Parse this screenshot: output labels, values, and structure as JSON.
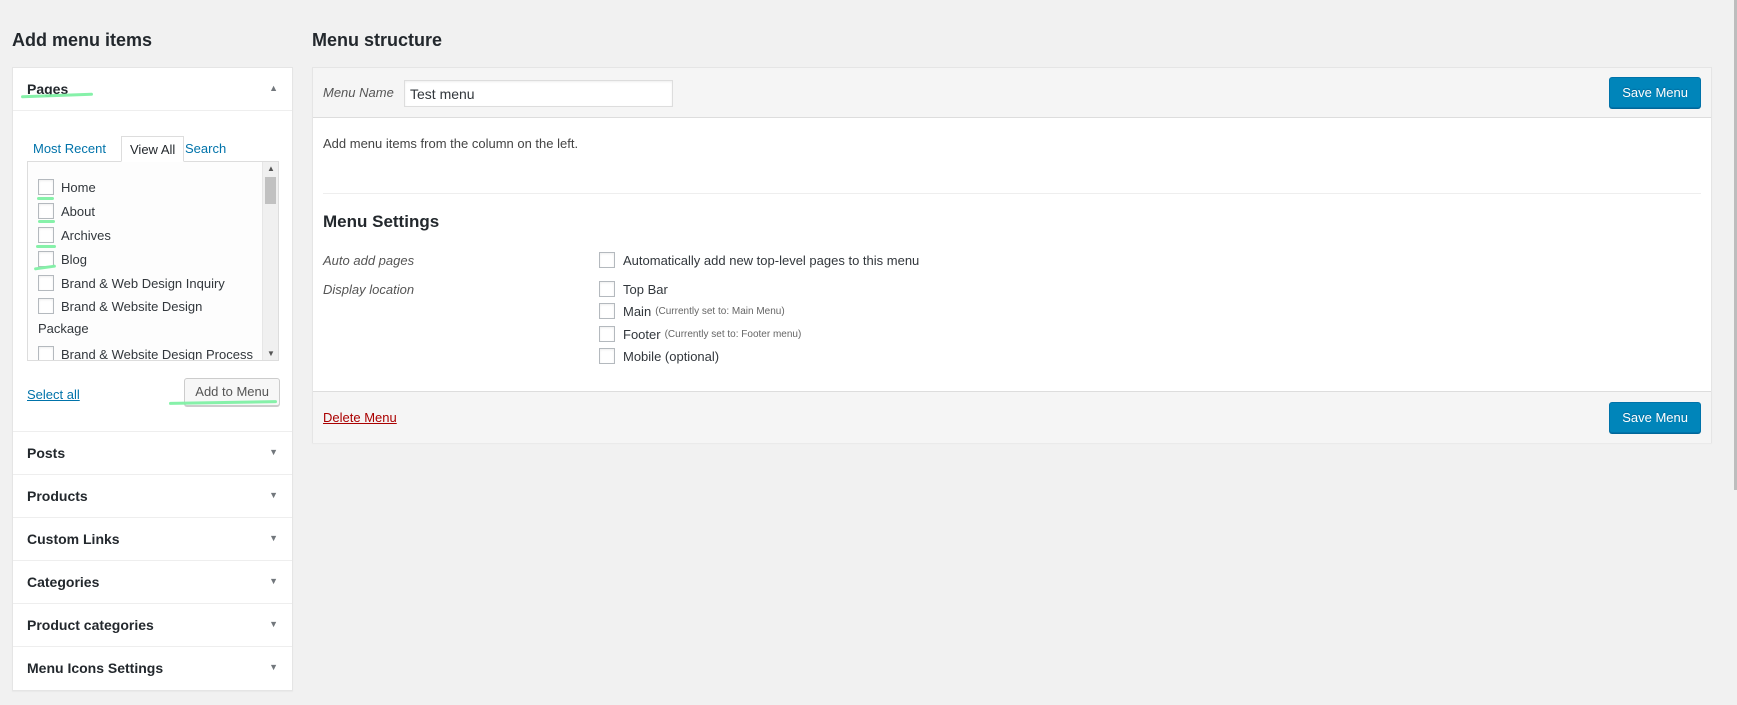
{
  "left": {
    "title": "Add menu items",
    "pages": {
      "label": "Pages",
      "tabs": [
        "Most Recent",
        "View All",
        "Search"
      ],
      "active_tab": "View All",
      "items": [
        "Home",
        "About",
        "Archives",
        "Blog",
        "Brand & Web Design Inquiry",
        "Brand & Website Design"
      ],
      "group_text": "Package",
      "last_item": "Brand & Website Design Process",
      "select_all": "Select all",
      "add_button": "Add to Menu"
    },
    "sections": [
      "Posts",
      "Products",
      "Custom Links",
      "Categories",
      "Product categories",
      "Menu Icons Settings"
    ]
  },
  "right": {
    "title": "Menu structure",
    "menu_name_label": "Menu Name",
    "menu_name_value": "Test menu",
    "save_label": "Save Menu",
    "hint": "Add menu items from the column on the left.",
    "settings_title": "Menu Settings",
    "auto_add_label": "Auto add pages",
    "auto_add_option": "Automatically add new top-level pages to this menu",
    "display_location_label": "Display location",
    "locations": [
      {
        "name": "Top Bar",
        "note": ""
      },
      {
        "name": "Main",
        "note": "(Currently set to: Main Menu)"
      },
      {
        "name": "Footer",
        "note": "(Currently set to: Footer menu)"
      },
      {
        "name": "Mobile (optional)",
        "note": ""
      }
    ],
    "delete_label": "Delete Menu"
  },
  "colors": {
    "primary": "#0085ba",
    "link": "#0073aa",
    "delete": "#aa0000",
    "highlight": "#7ff0a4"
  }
}
